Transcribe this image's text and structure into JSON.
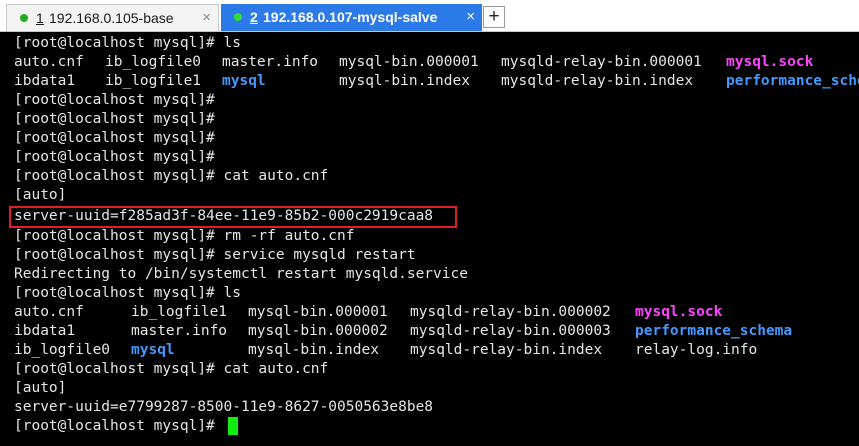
{
  "tabs": [
    {
      "number": "1",
      "label": "192.168.0.105-base",
      "close": "×",
      "status_color": "#22aa22"
    },
    {
      "number": "2",
      "label": "192.168.0.107-mysql-salve",
      "close": "×",
      "status_color": "#33dd33"
    }
  ],
  "add_tab": "+",
  "colors": {
    "background": "#000000",
    "text": "#e6e6e6",
    "socket_file": "#ff44ff",
    "directory": "#4499ff",
    "active_tab": "#2b7ae8",
    "highlight_border": "#e02020",
    "cursor": "#11ee11"
  },
  "terminal": {
    "lines": [
      "[root@localhost mysql]# ls",
      "",
      "",
      "[root@localhost mysql]#",
      "[root@localhost mysql]#",
      "[root@localhost mysql]#",
      "[root@localhost mysql]#",
      "[root@localhost mysql]# cat auto.cnf",
      "[auto]",
      "server-uuid=f285ad3f-84ee-11e9-85b2-000c2919caa8",
      "[root@localhost mysql]# rm -rf auto.cnf",
      "[root@localhost mysql]# service mysqld restart",
      "Redirecting to /bin/systemctl restart mysqld.service",
      "[root@localhost mysql]# ls",
      "",
      "",
      "",
      "[root@localhost mysql]# cat auto.cnf",
      "[auto]",
      "server-uuid=e7799287-8500-11e9-8627-0050563e8be8",
      "[root@localhost mysql]#"
    ],
    "ls1_row1": [
      "auto.cnf",
      "ib_logfile0",
      "master.info",
      "mysql-bin.000001",
      "mysqld-relay-bin.000001",
      "mysql.sock"
    ],
    "ls1_row2": [
      "ibdata1",
      "ib_logfile1",
      "mysql",
      "mysql-bin.index",
      "mysqld-relay-bin.index",
      "performance_sche"
    ],
    "ls2_row1": [
      "auto.cnf",
      "ib_logfile1",
      "mysql-bin.000001",
      "mysqld-relay-bin.000002",
      "mysql.sock"
    ],
    "ls2_row2": [
      "ibdata1",
      "master.info",
      "mysql-bin.000002",
      "mysqld-relay-bin.000003",
      "performance_schema"
    ],
    "ls2_row3": [
      "ib_logfile0",
      "mysql",
      "mysql-bin.index",
      "mysqld-relay-bin.index",
      "relay-log.info"
    ]
  }
}
